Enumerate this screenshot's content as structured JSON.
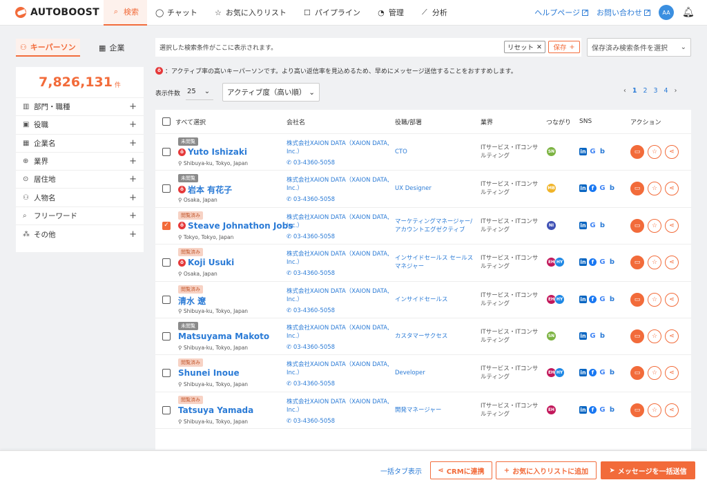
{
  "brand": {
    "name": "AUTOBOOST"
  },
  "nav": {
    "items": [
      {
        "label": "検索",
        "icon": "search-icon"
      },
      {
        "label": "チャット",
        "icon": "chat-icon"
      },
      {
        "label": "お気に入りリスト",
        "icon": "star-icon"
      },
      {
        "label": "パイプライン",
        "icon": "pipeline-icon"
      },
      {
        "label": "管理",
        "icon": "pie-icon"
      },
      {
        "label": "分析",
        "icon": "chart-icon"
      }
    ]
  },
  "header": {
    "help": "ヘルプページ",
    "contact": "お問い合わせ",
    "avatar": "AA"
  },
  "left_tabs": {
    "person": "キーパーソン",
    "company": "企業"
  },
  "result_count": {
    "value": "7,826,131",
    "unit": "件"
  },
  "filters": [
    "部門・職種",
    "役職",
    "企業名",
    "業界",
    "居住地",
    "人物名",
    "フリーワード",
    "その他"
  ],
  "search": {
    "placeholder_text": "選択した検索条件がここに表示されます。",
    "reset": "リセット",
    "save": "保存",
    "saved_select": "保存済み検索条件を選択"
  },
  "notice": {
    "hot_mark": "ô",
    "text": "：アクティブ率の高いキーパーソンです。より高い返信率を見込めるため、早めにメッセージ送信することをおすすめします。"
  },
  "controls": {
    "per_page_label": "表示件数",
    "per_page": "25",
    "sort": "アクティブ度（高い順）"
  },
  "pager": {
    "pages": [
      "1",
      "2",
      "3",
      "4"
    ],
    "current": "1"
  },
  "table": {
    "headers": {
      "select_all": "すべて選択",
      "company": "会社名",
      "role": "役職/部署",
      "industry": "業界",
      "connections": "つながり",
      "sns": "SNS",
      "actions": "アクション"
    },
    "rows": [
      {
        "badge": "未閲覧",
        "badge_type": "unread",
        "hot": true,
        "name": "Yuto Ishizaki",
        "location": "Shibuya-ku, Tokyo, Japan",
        "company": "株式会社XAION DATA（XAION DATA, Inc.）",
        "phone": "03-4360-5058",
        "role": "CTO",
        "industry": "ITサービス・ITコンサルティング",
        "connections": [
          {
            "t": "SN",
            "c": "#7cb342"
          }
        ],
        "sns": [
          "in",
          "G",
          "b"
        ],
        "checked": false
      },
      {
        "badge": "未閲覧",
        "badge_type": "unread",
        "hot": true,
        "name": "岩本 有花子",
        "location": "Osaka, Japan",
        "company": "株式会社XAION DATA（XAION DATA, Inc.）",
        "phone": "03-4360-5058",
        "role": "UX Designer",
        "industry": "ITサービス・ITコンサルティング",
        "connections": [
          {
            "t": "MB",
            "c": "#f0b429"
          }
        ],
        "sns": [
          "in",
          "f",
          "G",
          "b"
        ],
        "checked": false
      },
      {
        "badge": "閲覧済み",
        "badge_type": "read",
        "hot": true,
        "name": "Steave Johnathon Jobs",
        "location": "Tokyo, Tokyo, Japan",
        "company": "株式会社XAION DATA（XAION DATA, Inc.）",
        "phone": "03-4360-5058",
        "role": "マーケティングマネージャー/アカウントエグゼクティブ",
        "industry": "ITサービス・ITコンサルティング",
        "connections": [
          {
            "t": "NI",
            "c": "#3f51b5"
          }
        ],
        "sns": [
          "in",
          "G",
          "b"
        ],
        "checked": true
      },
      {
        "badge": "閲覧済み",
        "badge_type": "read",
        "hot": true,
        "name": "Koji Usuki",
        "location": "Osaka, Japan",
        "company": "株式会社XAION DATA（XAION DATA, Inc.）",
        "phone": "03-4360-5058",
        "role": "インサイドセールス セールスマネジャー",
        "industry": "ITサービス・ITコンサルティング",
        "connections": [
          {
            "t": "EH",
            "c": "#c2185b"
          },
          {
            "t": "HY",
            "c": "#1e88e5"
          }
        ],
        "sns": [
          "in",
          "f",
          "G",
          "b"
        ],
        "checked": false
      },
      {
        "badge": "閲覧済み",
        "badge_type": "read",
        "hot": false,
        "name": "清水 遼",
        "location": "Shibuya-ku, Tokyo, Japan",
        "company": "株式会社XAION DATA（XAION DATA, Inc.）",
        "phone": "03-4360-5058",
        "role": "インサイドセールス",
        "industry": "ITサービス・ITコンサルティング",
        "connections": [
          {
            "t": "EH",
            "c": "#c2185b"
          },
          {
            "t": "HY",
            "c": "#1e88e5"
          }
        ],
        "sns": [
          "in",
          "f",
          "G",
          "b"
        ],
        "checked": false
      },
      {
        "badge": "未閲覧",
        "badge_type": "unread",
        "hot": false,
        "name": "Matsuyama Makoto",
        "location": "Shibuya-ku, Tokyo, Japan",
        "company": "株式会社XAION DATA（XAION DATA, Inc.）",
        "phone": "03-4360-5058",
        "role": "カスタマーサクセス",
        "industry": "ITサービス・ITコンサルティング",
        "connections": [
          {
            "t": "SN",
            "c": "#7cb342"
          }
        ],
        "sns": [
          "in",
          "G",
          "b"
        ],
        "checked": false
      },
      {
        "badge": "閲覧済み",
        "badge_type": "read",
        "hot": false,
        "name": "Shunei Inoue",
        "location": "Shibuya-ku, Tokyo, Japan",
        "company": "株式会社XAION DATA（XAION DATA, Inc.）",
        "phone": "03-4360-5058",
        "role": "Developer",
        "industry": "ITサービス・ITコンサルティング",
        "connections": [
          {
            "t": "EH",
            "c": "#c2185b"
          },
          {
            "t": "HY",
            "c": "#1e88e5"
          }
        ],
        "sns": [
          "in",
          "f",
          "G",
          "b"
        ],
        "checked": false
      },
      {
        "badge": "閲覧済み",
        "badge_type": "read",
        "hot": false,
        "name": "Tatsuya Yamada",
        "location": "Shibuya-ku, Tokyo, Japan",
        "company": "株式会社XAION DATA（XAION DATA, Inc.）",
        "phone": "03-4360-5058",
        "role": "開発マネージャー",
        "industry": "ITサービス・ITコンサルティング",
        "connections": [
          {
            "t": "EH",
            "c": "#c2185b"
          }
        ],
        "sns": [
          "in",
          "f",
          "G",
          "b"
        ],
        "checked": false
      }
    ]
  },
  "footer": {
    "bulk_tab": "一括タブ表示",
    "crm": "CRMに連携",
    "add_fav": "お気に入りリストに追加",
    "send": "メッセージを一括送信"
  },
  "colors": {
    "accent": "#f26b3a",
    "link": "#2b7bd6"
  }
}
